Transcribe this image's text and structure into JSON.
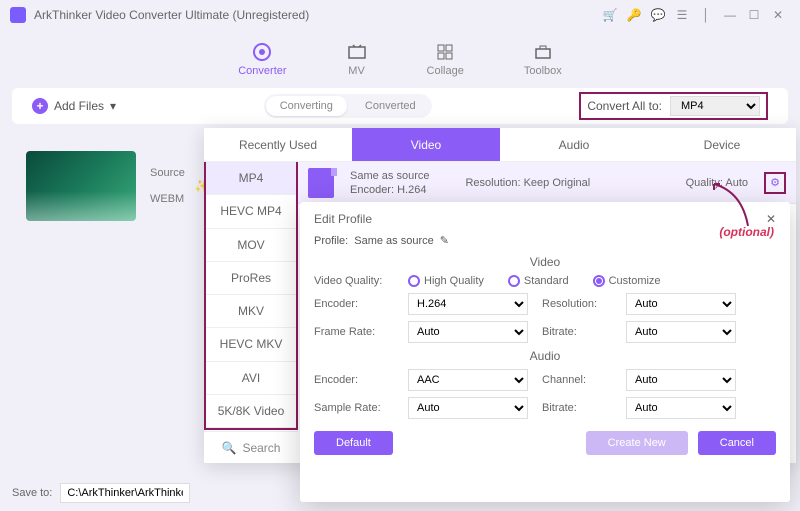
{
  "window": {
    "title": "ArkThinker Video Converter Ultimate (Unregistered)"
  },
  "nav": {
    "converter": "Converter",
    "mv": "MV",
    "collage": "Collage",
    "toolbox": "Toolbox"
  },
  "mainbar": {
    "addfiles": "Add Files",
    "converting": "Converting",
    "converted": "Converted",
    "convall": "Convert All to:",
    "convall_val": "MP4"
  },
  "filerow": {
    "source": "Source",
    "format": "WEBM"
  },
  "fmttabs": {
    "recent": "Recently Used",
    "video": "Video",
    "audio": "Audio",
    "device": "Device"
  },
  "formats": {
    "mp4": "MP4",
    "hevcmp4": "HEVC MP4",
    "mov": "MOV",
    "prores": "ProRes",
    "mkv": "MKV",
    "hevcmkv": "HEVC MKV",
    "avi": "AVI",
    "five8k": "5K/8K Video"
  },
  "search": "Search",
  "preset": {
    "name": "Same as source",
    "encoder": "Encoder: H.264",
    "resolution": "Resolution: Keep Original",
    "quality": "Quality: Auto"
  },
  "edit": {
    "title": "Edit Profile",
    "close": "✕",
    "profile_label": "Profile:",
    "profile_value": "Same as source",
    "video_sect": "Video",
    "audio_sect": "Audio",
    "vq_label": "Video Quality:",
    "hq": "High Quality",
    "std": "Standard",
    "cust": "Customize",
    "enc_label": "Encoder:",
    "enc_val": "H.264",
    "res_label": "Resolution:",
    "res_val": "Auto",
    "fr_label": "Frame Rate:",
    "fr_val": "Auto",
    "br_label": "Bitrate:",
    "br_val": "Auto",
    "aenc_label": "Encoder:",
    "aenc_val": "AAC",
    "ch_label": "Channel:",
    "ch_val": "Auto",
    "sr_label": "Sample Rate:",
    "sr_val": "Auto",
    "abr_label": "Bitrate:",
    "abr_val": "Auto",
    "default": "Default",
    "createnew": "Create New",
    "cancel": "Cancel"
  },
  "optional": "(optional)",
  "bottom": {
    "saveto": "Save to:",
    "path": "C:\\ArkThinker\\ArkThinke...rter"
  }
}
